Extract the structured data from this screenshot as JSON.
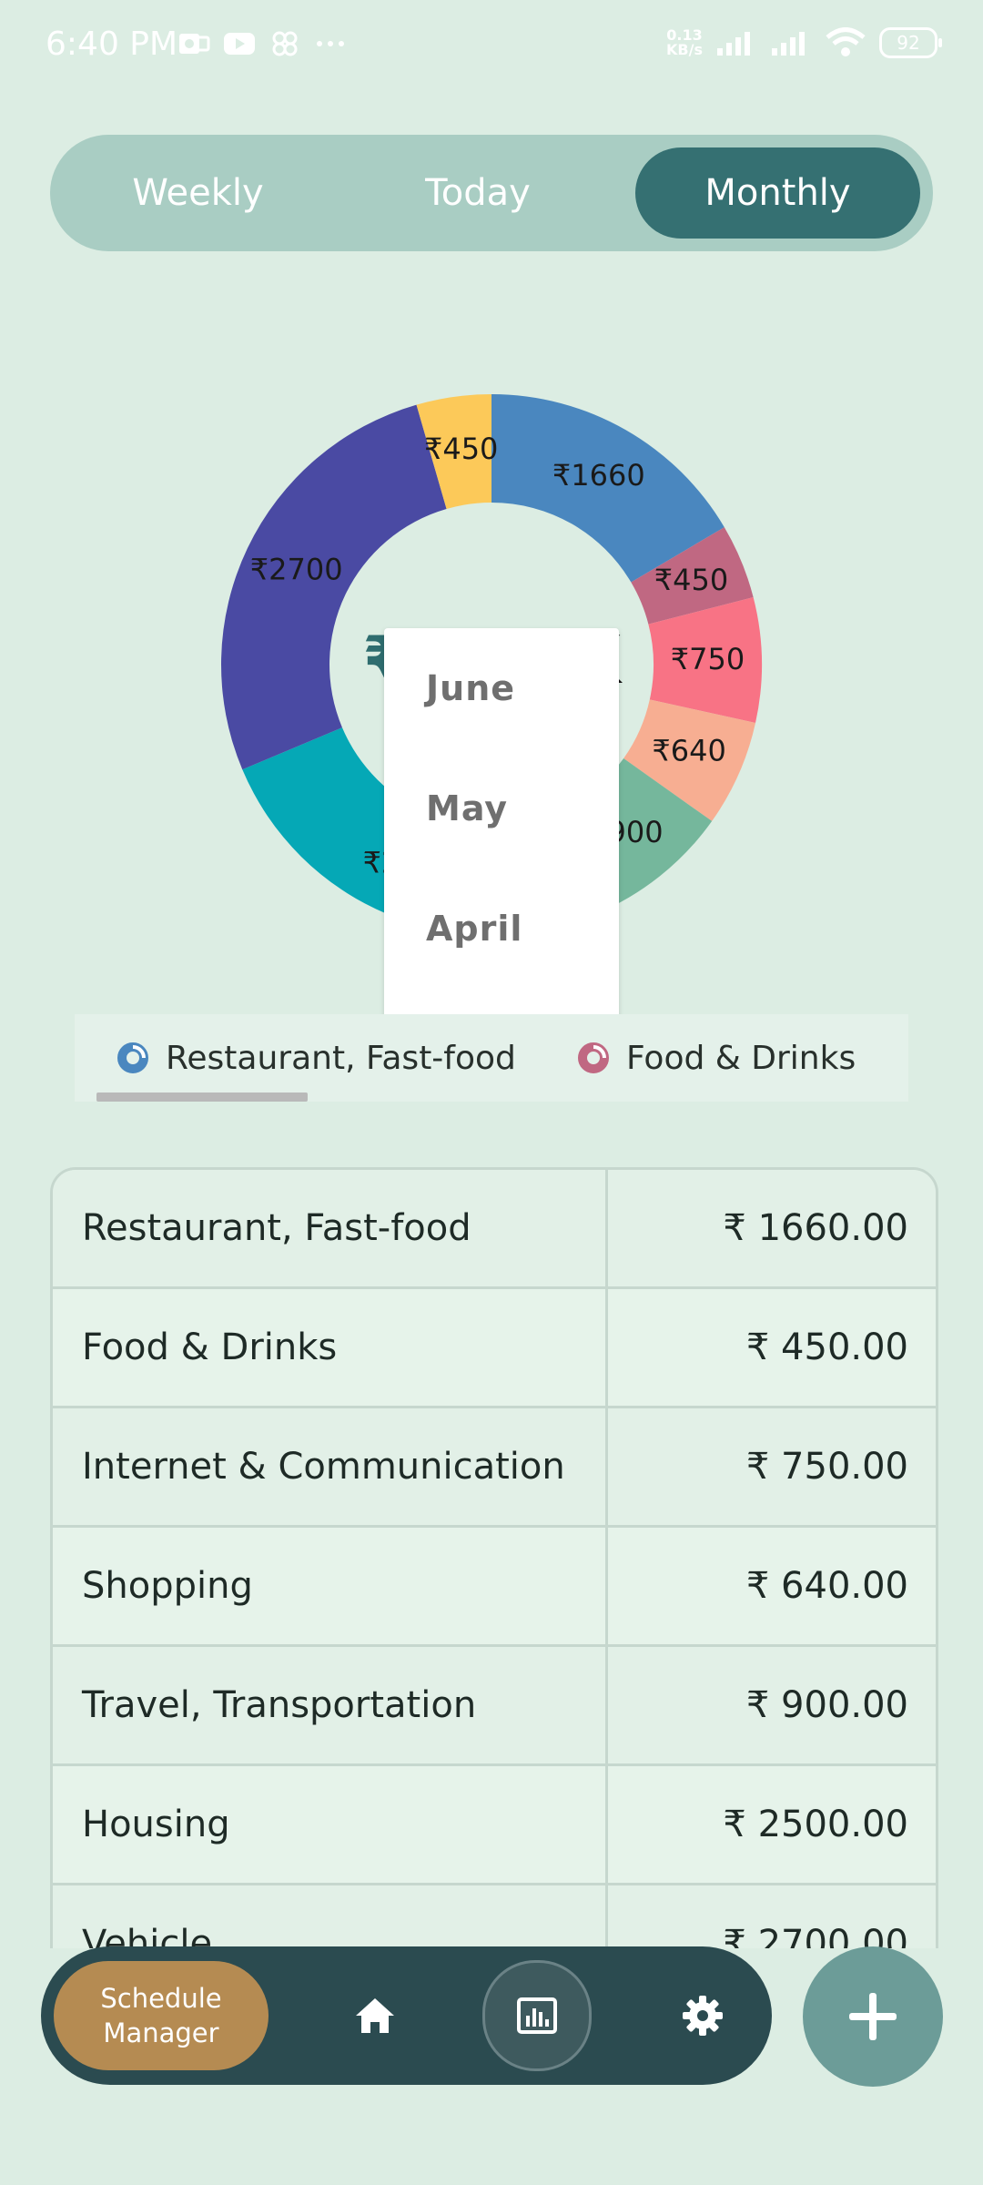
{
  "status_bar": {
    "time": "6:40 PM",
    "network_speed_value": "0.13",
    "network_speed_unit": "KB/s",
    "battery": "92"
  },
  "period_tabs": [
    {
      "label": "Weekly",
      "selected": false
    },
    {
      "label": "Today",
      "selected": false
    },
    {
      "label": "Monthly",
      "selected": true
    }
  ],
  "chart_data": {
    "type": "pie",
    "style": "donut",
    "center_total": "₹10.1K",
    "slices": [
      {
        "label": "₹1660",
        "value": 1660,
        "color": "#4a87bf"
      },
      {
        "label": "₹450",
        "value": 450,
        "color": "#c06882"
      },
      {
        "label": "₹750",
        "value": 750,
        "color": "#f87385"
      },
      {
        "label": "₹640",
        "value": 640,
        "color": "#f7ae92"
      },
      {
        "label": "₹900",
        "value": 900,
        "color": "#75b79c"
      },
      {
        "label": "₹2500",
        "value": 2500,
        "color": "#05a8b6"
      },
      {
        "label": "₹2700",
        "value": 2700,
        "color": "#4a4aa3"
      },
      {
        "label": "₹450",
        "value": 450,
        "color": "#fcc959"
      }
    ]
  },
  "month_dropdown": {
    "options": [
      "June",
      "May",
      "April"
    ]
  },
  "legend": [
    {
      "label": "Restaurant, Fast-food",
      "color": "#4a87bf",
      "icon": "donut-icon"
    },
    {
      "label": "Food & Drinks",
      "color": "#c06882",
      "icon": "donut-icon"
    }
  ],
  "expense_table": [
    {
      "category": "Restaurant, Fast-food",
      "amount": "₹ 1660.00"
    },
    {
      "category": "Food & Drinks",
      "amount": "₹ 450.00"
    },
    {
      "category": "Internet & Communication",
      "amount": "₹ 750.00"
    },
    {
      "category": "Shopping",
      "amount": "₹ 640.00"
    },
    {
      "category": "Travel, Transportation",
      "amount": "₹ 900.00"
    },
    {
      "category": "Housing",
      "amount": "₹ 2500.00"
    },
    {
      "category": "Vehicle",
      "amount": "₹ 2700.00"
    }
  ],
  "bottom_nav": {
    "schedule_line1": "Schedule",
    "schedule_line2": "Manager",
    "icons": [
      "home-icon",
      "bar-chart-icon",
      "gear-icon"
    ],
    "fab_icon": "plus-icon"
  },
  "colors": {
    "background": "#dcede3",
    "accent": "#357072",
    "nav_bg": "#2b4b50",
    "schedule_btn": "#b58b52",
    "fab": "#6c9c98"
  }
}
